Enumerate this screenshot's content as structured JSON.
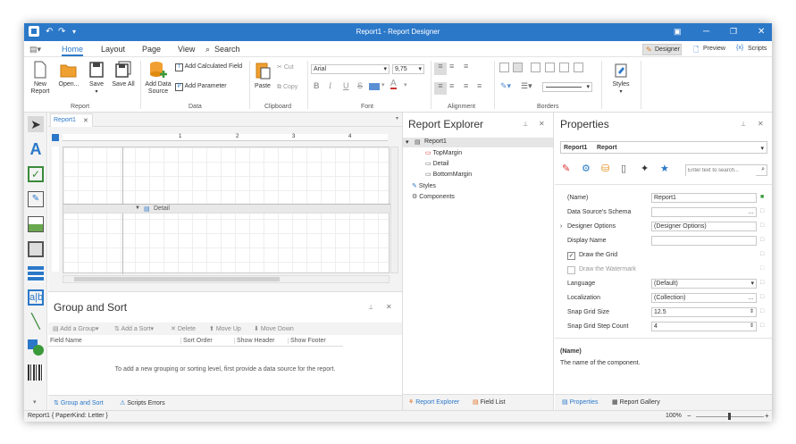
{
  "app": {
    "title": "Report1 - Report Designer"
  },
  "menu": {
    "home": "Home",
    "layout": "Layout",
    "page": "Page",
    "view": "View",
    "search": "Search"
  },
  "view_switch": {
    "designer": "Designer",
    "preview": "Preview",
    "scripts": "Scripts"
  },
  "ribbon": {
    "report": {
      "group": "Report",
      "new_report": "New Report",
      "open": "Open...",
      "save": "Save",
      "save_all": "Save All"
    },
    "data": {
      "group": "Data",
      "add_data_source": "Add Data Source",
      "add_calculated_field": "Add Calculated Field",
      "add_parameter": "Add Parameter"
    },
    "clipboard": {
      "group": "Clipboard",
      "paste": "Paste",
      "cut": "Cut",
      "copy": "Copy"
    },
    "font": {
      "group": "Font",
      "family": "Arial",
      "size": "9,75",
      "bold": "B",
      "italic": "I",
      "underline": "U",
      "strike": "S",
      "fore": "A"
    },
    "alignment": {
      "group": "Alignment"
    },
    "borders": {
      "group": "Borders"
    },
    "styles": {
      "label": "Styles"
    }
  },
  "doc_tab": {
    "label": "Report1"
  },
  "ruler": {
    "marks": [
      "1",
      "2",
      "3",
      "4"
    ]
  },
  "band": {
    "detail": "Detail"
  },
  "group_sort": {
    "title": "Group and Sort",
    "add_group": "Add a Group",
    "add_sort": "Add a Sort",
    "delete": "Delete",
    "move_up": "Move Up",
    "move_down": "Move Down",
    "columns": [
      "Field Name",
      "Sort Order",
      "Show Header",
      "Show Footer"
    ],
    "empty_msg": "To add a new grouping or sorting level, first provide a data source for the report.",
    "tab_group_sort": "Group and Sort",
    "tab_scripts_errors": "Scripts Errors"
  },
  "explorer": {
    "title": "Report Explorer",
    "tree": {
      "root": "Report1",
      "top": "TopMargin",
      "detail": "Detail",
      "bottom": "BottomMargin",
      "styles": "Styles",
      "components": "Components"
    },
    "tab_explorer": "Report Explorer",
    "tab_field_list": "Field List"
  },
  "properties": {
    "title": "Properties",
    "selector_name": "Report1",
    "selector_type": "Report",
    "search_placeholder": "Enter text to search...",
    "rows": [
      {
        "label": "(Name)",
        "value": "Report1"
      },
      {
        "label": "Data Source's Schema",
        "value": ""
      },
      {
        "label": "Designer Options",
        "value": "(Designer Options)"
      },
      {
        "label": "Display Name",
        "value": ""
      },
      {
        "label": "Draw the Grid",
        "value": ""
      },
      {
        "label": "Draw the Watermark",
        "value": ""
      },
      {
        "label": "Language",
        "value": "(Default)"
      },
      {
        "label": "Localization",
        "value": "(Collection)"
      },
      {
        "label": "Snap Grid Size",
        "value": "12.5"
      },
      {
        "label": "Snap Grid Step Count",
        "value": "4"
      }
    ],
    "desc_title": "(Name)",
    "desc_text": "The name of the component.",
    "tab_properties": "Properties",
    "tab_gallery": "Report Gallery"
  },
  "status": {
    "left": "Report1 { PaperKind: Letter }",
    "zoom": "100%"
  }
}
